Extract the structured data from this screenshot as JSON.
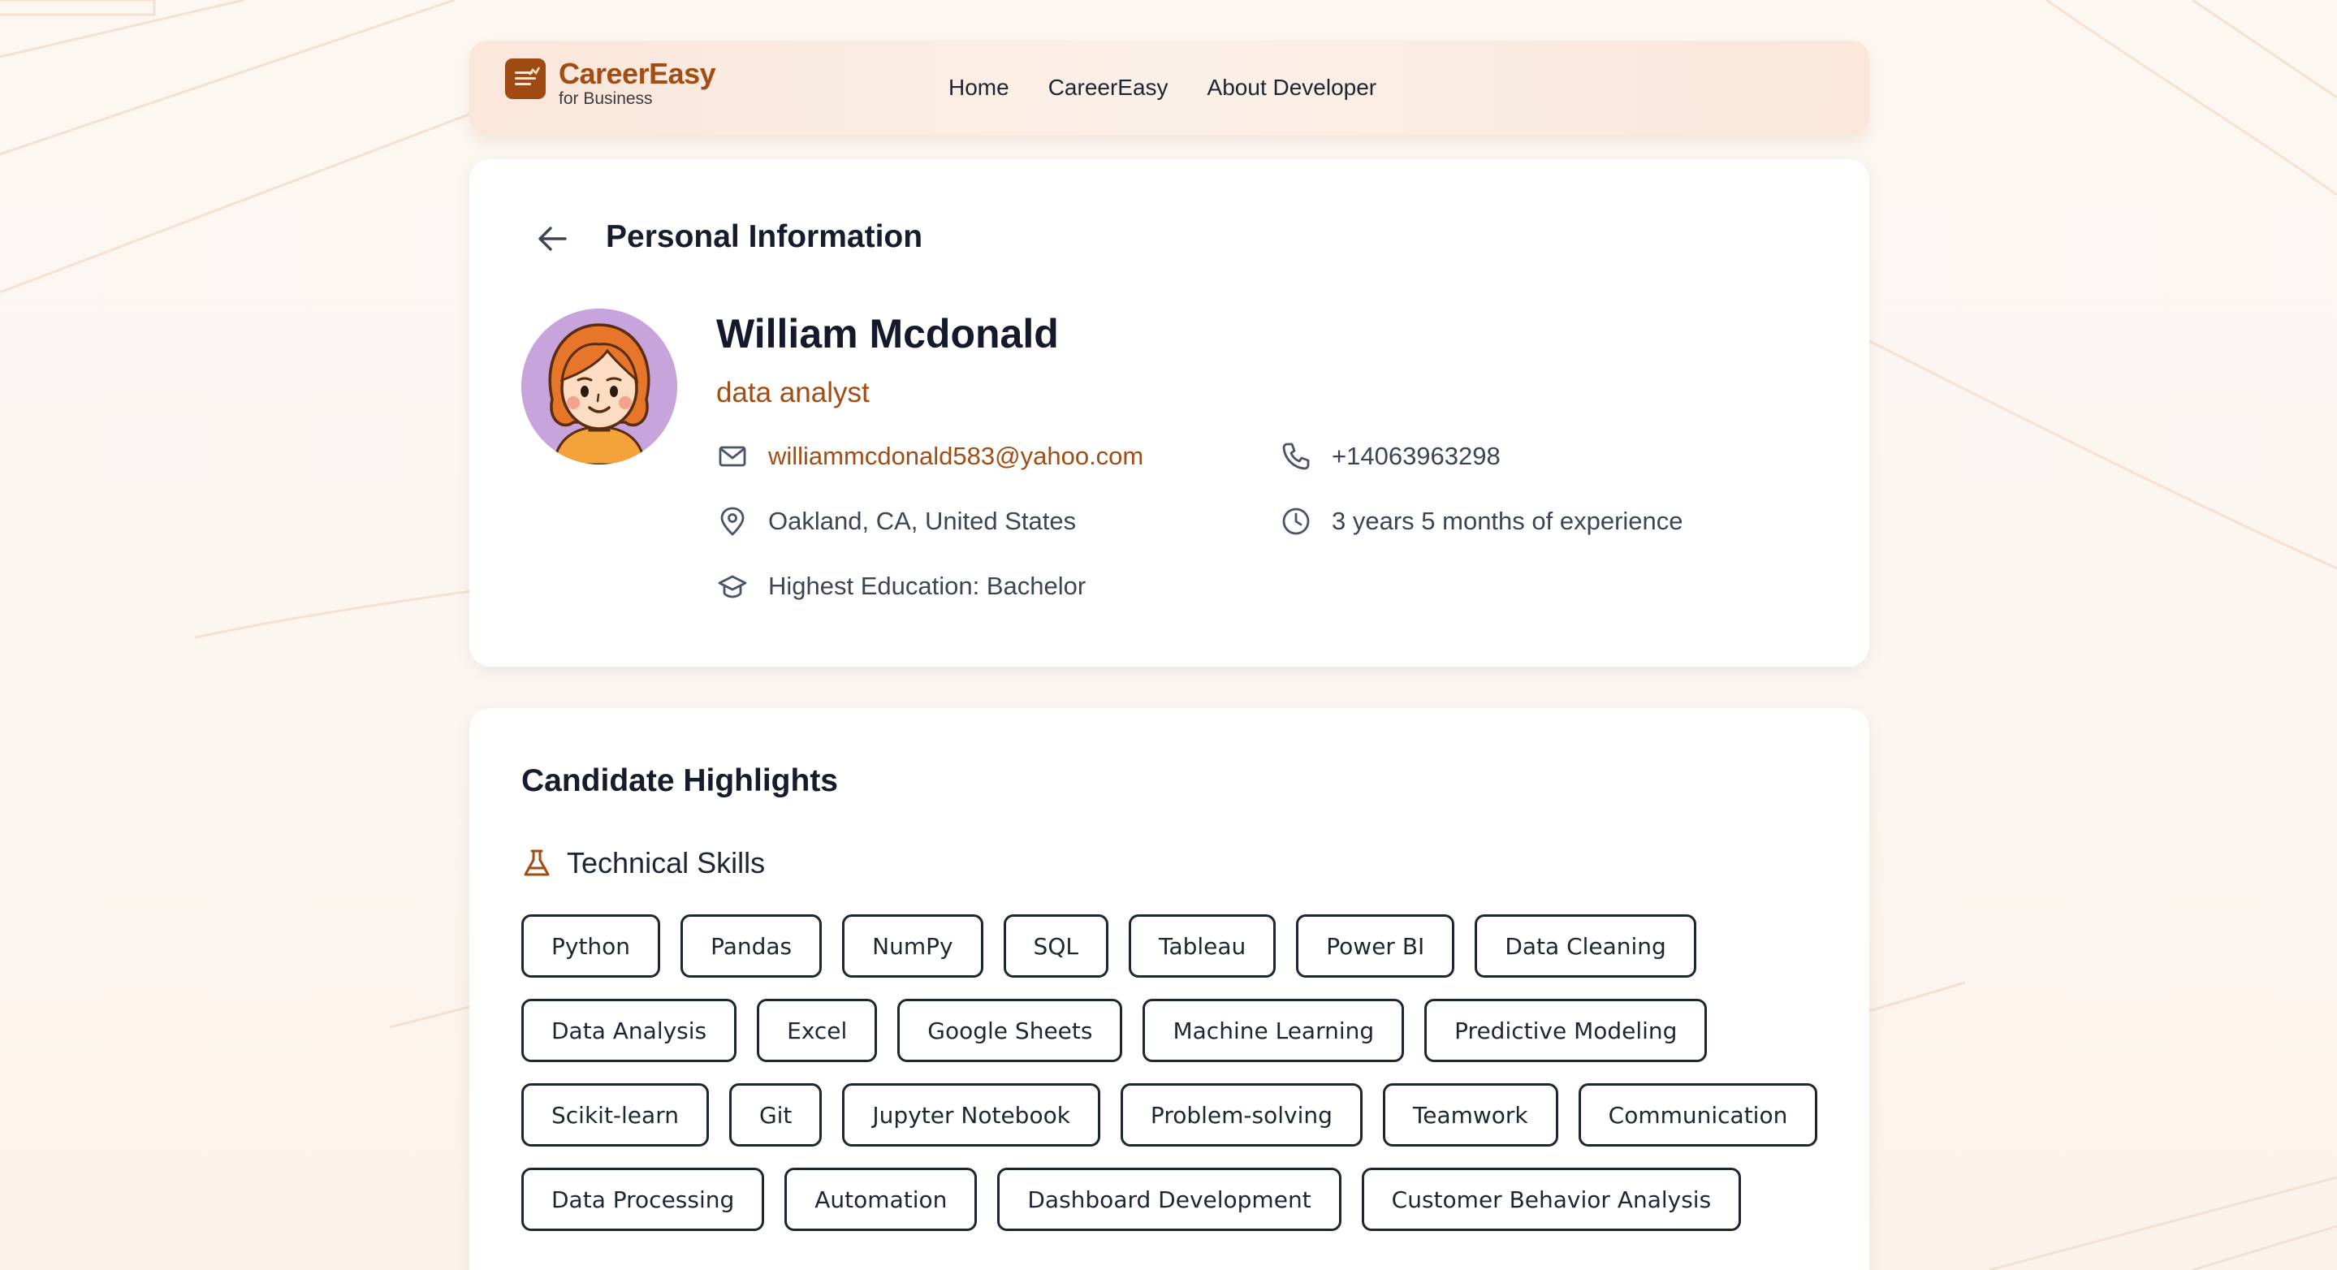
{
  "brand": {
    "title": "CareerEasy",
    "subtitle": "for Business",
    "color": "#a14d14"
  },
  "nav": {
    "items": [
      "Home",
      "CareerEasy",
      "About Developer"
    ]
  },
  "personal": {
    "title": "Personal Information",
    "name": "William Mcdonald",
    "role": "data analyst",
    "email": "williammcdonald583@yahoo.com",
    "phone": "+14063963298",
    "location": "Oakland, CA, United States",
    "experience": "3 years 5 months of experience",
    "education": "Highest Education: Bachelor"
  },
  "highlights": {
    "title": "Candidate Highlights",
    "technical_label": "Technical Skills",
    "skills": [
      "Python",
      "Pandas",
      "NumPy",
      "SQL",
      "Tableau",
      "Power BI",
      "Data Cleaning",
      "Data Analysis",
      "Excel",
      "Google Sheets",
      "Machine Learning",
      "Predictive Modeling",
      "Scikit-learn",
      "Git",
      "Jupyter Notebook",
      "Problem-solving",
      "Teamwork",
      "Communication",
      "Data Processing",
      "Automation",
      "Dashboard Development",
      "Customer Behavior Analysis"
    ]
  },
  "icons": {
    "back": "arrow-left-icon",
    "email": "mail-icon",
    "phone": "phone-icon",
    "location": "map-pin-icon",
    "experience": "clock-icon",
    "education": "graduation-cap-icon",
    "skills": "flask-icon"
  }
}
